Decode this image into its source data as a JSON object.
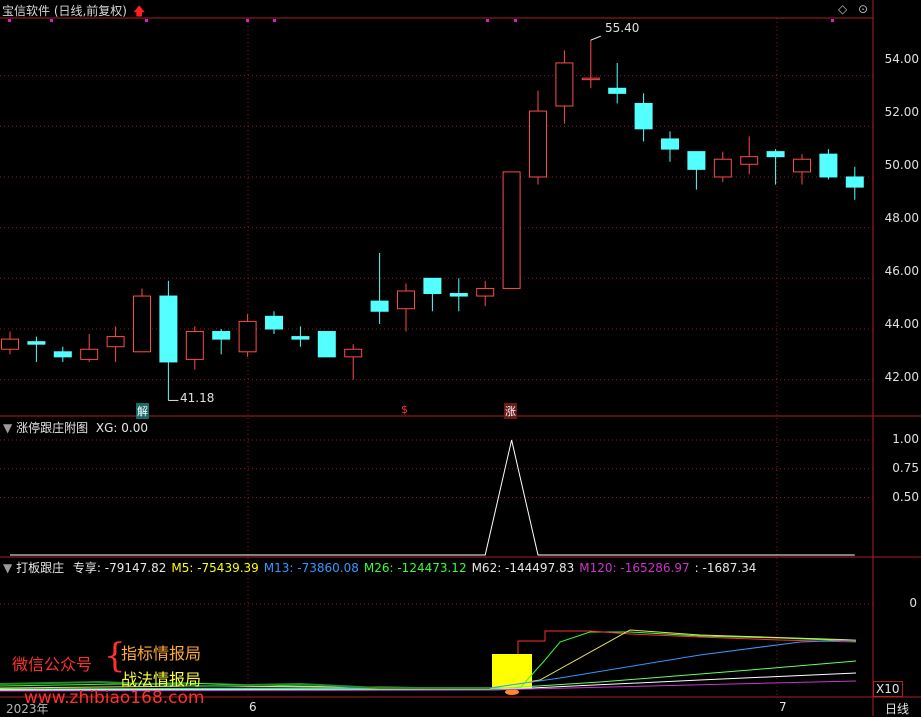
{
  "window": {
    "title": "宝信软件 (日线,前复权)",
    "controls": [
      "◇",
      "⊙"
    ]
  },
  "main_panel": {
    "price_axis": [
      "54.00",
      "52.00",
      "50.00",
      "48.00",
      "46.00",
      "44.00",
      "42.00"
    ],
    "high_label": "55.40",
    "low_label": "41.18",
    "event_markers": [
      "解",
      "$",
      "涨"
    ]
  },
  "sub1": {
    "title": "涨停跟庄附图",
    "value_text": "XG: 0.00",
    "axis": [
      "1.00",
      "0.75",
      "0.50"
    ]
  },
  "sub2": {
    "title": "打板跟庄",
    "items": [
      {
        "label": "专享:",
        "value": "-79147.82",
        "color": "#e6e6e6"
      },
      {
        "label": "M5:",
        "value": "-75439.39",
        "color": "#ffff00"
      },
      {
        "label": "M13:",
        "value": "-73860.08",
        "color": "#3399ff"
      },
      {
        "label": "M26:",
        "value": "-124473.12",
        "color": "#33ff33"
      },
      {
        "label": "M62:",
        "value": "-144497.83",
        "color": "#e6e6e6"
      },
      {
        "label": "M120:",
        "value": "-165286.97",
        "color": "#cc33cc"
      },
      {
        "label": ":",
        "value": "-1687.34",
        "color": "#e6e6e6"
      }
    ],
    "axis": [
      "0"
    ]
  },
  "overlay": {
    "wechat_label": "微信公众号",
    "brace": "{",
    "line1": "指标情报局",
    "line2": "战法情报局",
    "watermark": "www.zhibiao168.com"
  },
  "footer": {
    "year_label": "2023年",
    "month_6": "6",
    "month_7": "7",
    "zoom": "X10",
    "period": "日线"
  },
  "colors": {
    "up": "#ff4a4a",
    "down": "#54ffff",
    "grid": "#8b1a1a",
    "border": "#b01e1e"
  },
  "chart_data": {
    "type": "candlestick",
    "title": "宝信软件 (日线,前复权)",
    "ylim": [
      41,
      55.8
    ],
    "candles": [
      {
        "o": 43.2,
        "c": 43.6,
        "h": 43.9,
        "l": 43.0
      },
      {
        "o": 43.5,
        "c": 43.4,
        "h": 43.7,
        "l": 42.7
      },
      {
        "o": 43.1,
        "c": 42.9,
        "h": 43.3,
        "l": 42.7
      },
      {
        "o": 42.8,
        "c": 43.2,
        "h": 43.8,
        "l": 42.7
      },
      {
        "o": 43.3,
        "c": 43.7,
        "h": 44.1,
        "l": 42.7
      },
      {
        "o": 43.1,
        "c": 45.3,
        "h": 45.6,
        "l": 43.1
      },
      {
        "o": 45.3,
        "c": 42.7,
        "h": 45.9,
        "l": 41.18
      },
      {
        "o": 42.8,
        "c": 43.9,
        "h": 44.1,
        "l": 42.4
      },
      {
        "o": 43.9,
        "c": 43.6,
        "h": 44.0,
        "l": 43.0
      },
      {
        "o": 43.1,
        "c": 44.3,
        "h": 44.6,
        "l": 42.9
      },
      {
        "o": 44.5,
        "c": 44.0,
        "h": 44.7,
        "l": 43.8
      },
      {
        "o": 43.7,
        "c": 43.6,
        "h": 44.1,
        "l": 43.3
      },
      {
        "o": 43.9,
        "c": 42.9,
        "h": 43.9,
        "l": 42.9
      },
      {
        "o": 42.9,
        "c": 43.2,
        "h": 43.4,
        "l": 42.0
      },
      {
        "o": 45.1,
        "c": 44.7,
        "h": 47.0,
        "l": 44.2
      },
      {
        "o": 44.8,
        "c": 45.5,
        "h": 45.8,
        "l": 43.9
      },
      {
        "o": 46.0,
        "c": 45.4,
        "h": 46.0,
        "l": 44.7
      },
      {
        "o": 45.4,
        "c": 45.3,
        "h": 46.0,
        "l": 44.7
      },
      {
        "o": 45.3,
        "c": 45.6,
        "h": 45.9,
        "l": 44.9
      },
      {
        "o": 45.6,
        "c": 50.2,
        "h": 50.2,
        "l": 45.6
      },
      {
        "o": 50.0,
        "c": 52.6,
        "h": 53.4,
        "l": 49.7
      },
      {
        "o": 52.8,
        "c": 54.5,
        "h": 55.0,
        "l": 52.1
      },
      {
        "o": 53.9,
        "c": 53.9,
        "h": 55.4,
        "l": 53.5
      },
      {
        "o": 53.5,
        "c": 53.3,
        "h": 54.5,
        "l": 52.9
      },
      {
        "o": 52.9,
        "c": 51.9,
        "h": 53.3,
        "l": 51.4
      },
      {
        "o": 51.5,
        "c": 51.1,
        "h": 51.8,
        "l": 50.6
      },
      {
        "o": 51.0,
        "c": 50.3,
        "h": 51.0,
        "l": 49.5
      },
      {
        "o": 50.0,
        "c": 50.7,
        "h": 51.0,
        "l": 49.8
      },
      {
        "o": 50.5,
        "c": 50.8,
        "h": 51.6,
        "l": 50.1
      },
      {
        "o": 51.0,
        "c": 50.8,
        "h": 51.1,
        "l": 49.7
      },
      {
        "o": 50.2,
        "c": 50.7,
        "h": 50.9,
        "l": 49.7
      },
      {
        "o": 50.9,
        "c": 50.0,
        "h": 51.1,
        "l": 49.9
      },
      {
        "o": 50.0,
        "c": 49.6,
        "h": 50.4,
        "l": 49.1
      }
    ],
    "sub1_series": {
      "name": "XG",
      "values": [
        0,
        0,
        0,
        0,
        0,
        0,
        0,
        0,
        0,
        0,
        0,
        0,
        0,
        0,
        0,
        0,
        0,
        0,
        0,
        1,
        0,
        0,
        0,
        0,
        0,
        0,
        0,
        0,
        0,
        0,
        0,
        0,
        0
      ],
      "ylim": [
        0,
        1
      ]
    }
  }
}
